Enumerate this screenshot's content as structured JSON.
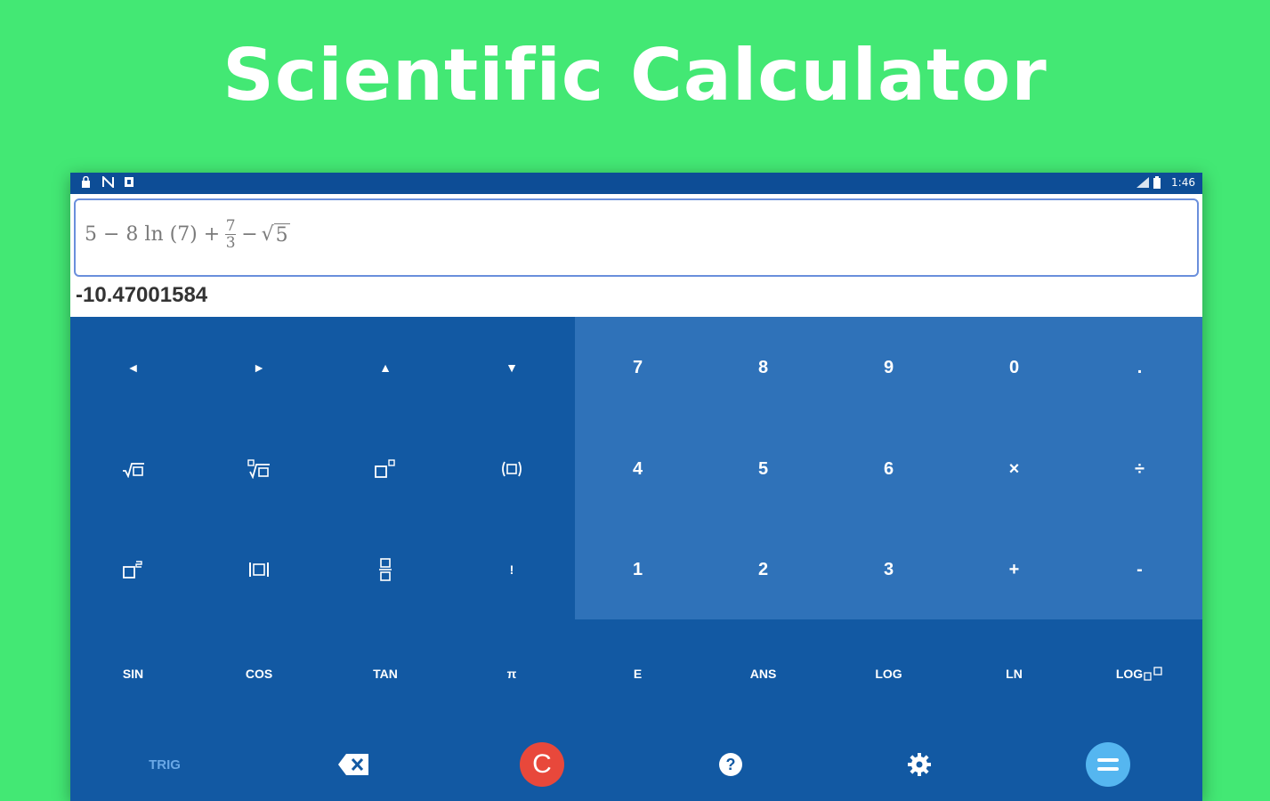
{
  "headline": "Scientific Calculator",
  "status_bar": {
    "left_icons": [
      "lock-icon",
      "nfc-icon",
      "notification-icon"
    ],
    "right_icons": [
      "signal-icon",
      "battery-icon"
    ],
    "time": "1:46"
  },
  "display": {
    "expression": {
      "prefix": "5 − 8 ln (7) +",
      "fraction_numerator": "7",
      "fraction_denominator": "3",
      "suffix_op": "−",
      "sqrt_symbol": "√",
      "sqrt_radicand": "5"
    },
    "result": "-10.47001584"
  },
  "keys": {
    "row1": [
      "◄",
      "►",
      "▲",
      "▼",
      "7",
      "8",
      "9",
      "0",
      "."
    ],
    "row2": [
      "nth-root-icon",
      "sqrt-box-icon",
      "power-box-icon",
      "parentheses-icon",
      "4",
      "5",
      "6",
      "×",
      "÷"
    ],
    "row2_numeric": [
      "4",
      "5",
      "6",
      "×",
      "÷"
    ],
    "row3": [
      "square-box-icon",
      "abs-box-icon",
      "fraction-box-icon",
      "!",
      "1",
      "2",
      "3",
      "+",
      "-"
    ],
    "row4": [
      "SIN",
      "COS",
      "TAN",
      "π",
      "E",
      "ANS",
      "LOG",
      "LN",
      "LOG"
    ]
  },
  "bottom": {
    "trig_label": "TRIG",
    "clear_label": "C",
    "help_label": "?"
  },
  "colors": {
    "background": "#43e874",
    "keypad": "#1259a3",
    "numpad": "#2f72b9",
    "clear": "#e8483b",
    "equals": "#55b6f0"
  }
}
